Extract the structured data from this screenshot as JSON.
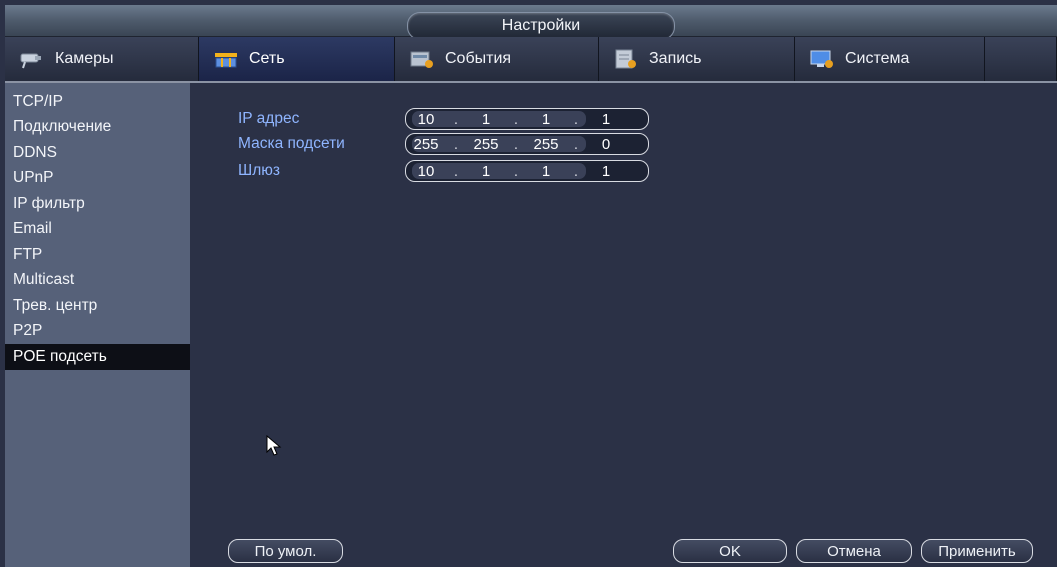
{
  "window": {
    "title": "Настройки"
  },
  "tabs": [
    {
      "label": "Камеры",
      "icon": "camera-icon"
    },
    {
      "label": "Сеть",
      "icon": "network-icon"
    },
    {
      "label": "События",
      "icon": "events-icon"
    },
    {
      "label": "Запись",
      "icon": "record-icon"
    },
    {
      "label": "Система",
      "icon": "system-icon"
    }
  ],
  "sidebar": {
    "items": [
      {
        "label": "TCP/IP"
      },
      {
        "label": "Подключение"
      },
      {
        "label": "DDNS"
      },
      {
        "label": "UPnP"
      },
      {
        "label": "IP фильтр"
      },
      {
        "label": "Email"
      },
      {
        "label": "FTP"
      },
      {
        "label": "Multicast"
      },
      {
        "label": "Трев. центр"
      },
      {
        "label": "P2P"
      },
      {
        "label": "POE подсеть"
      }
    ]
  },
  "form": {
    "ip": {
      "label": "IP адрес",
      "octets": [
        "10",
        "1",
        "1",
        "1"
      ]
    },
    "mask": {
      "label": "Маска подсети",
      "octets": [
        "255",
        "255",
        "255",
        "0"
      ]
    },
    "gateway": {
      "label": "Шлюз",
      "octets": [
        "10",
        "1",
        "1",
        "1"
      ]
    }
  },
  "buttons": {
    "default": "По умол.",
    "ok": "OK",
    "cancel": "Отмена",
    "apply": "Применить"
  },
  "colors": {
    "label": "#8fb5ff",
    "sidebar_bg": "#566179",
    "panel_bg": "#2b3146",
    "active_item_bg": "#0d0f16"
  }
}
